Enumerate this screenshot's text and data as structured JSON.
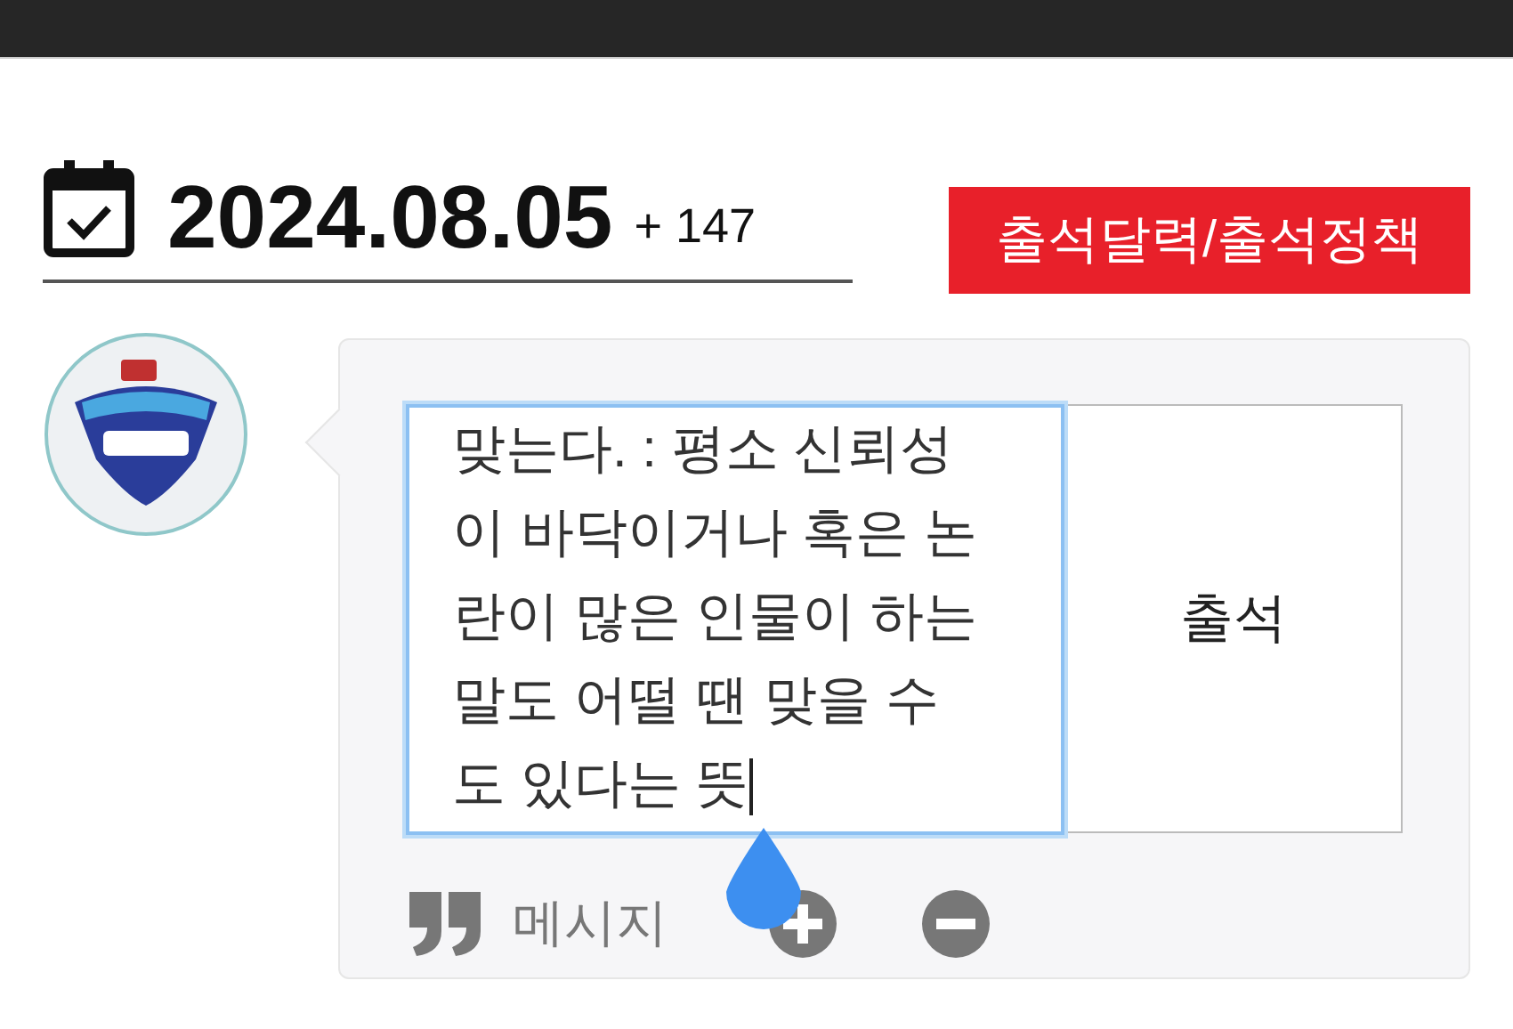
{
  "header": {
    "date": "2024.08.05",
    "count": "+ 147",
    "policy_button": "출석달력/출석정책"
  },
  "message": {
    "focused": true,
    "lines": [
      "맞는다. : 평소 신뢰성",
      "이 바닥이거나 혹은 논",
      "란이 많은 인물이 하는",
      "말도 어떨 땐 맞을 수",
      "도 있다는 뜻"
    ],
    "submit": "출석",
    "label": "메시지"
  }
}
